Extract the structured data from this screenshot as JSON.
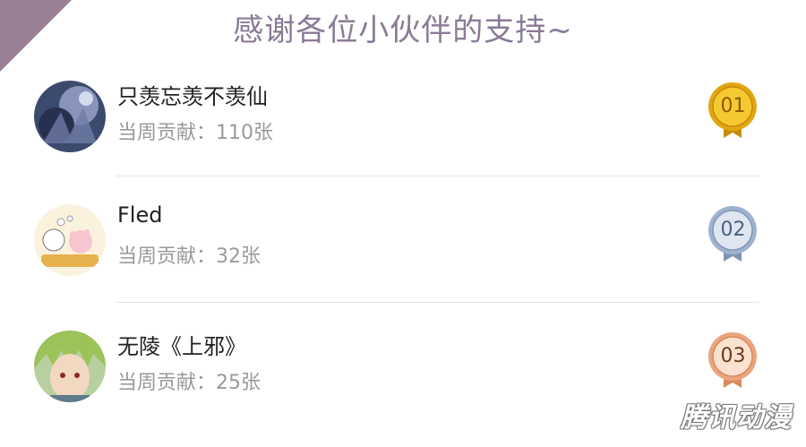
{
  "header": {
    "title": "感谢各位小伙伴的支持~"
  },
  "ranking": [
    {
      "name": "只羡忘羡不羡仙",
      "contribution": "当周贡献：110张",
      "rank": "01",
      "medal_color": "#e3a612"
    },
    {
      "name": "Fled",
      "contribution": "当周贡献：32张",
      "rank": "02",
      "medal_color": "#9fb3cf"
    },
    {
      "name": "无陵《上邪》",
      "contribution": "当周贡献：25张",
      "rank": "03",
      "medal_color": "#eaa57c"
    }
  ],
  "watermark": "腾讯动漫",
  "colors": {
    "accent": "#8a7a96",
    "corner": "#9a8096"
  }
}
